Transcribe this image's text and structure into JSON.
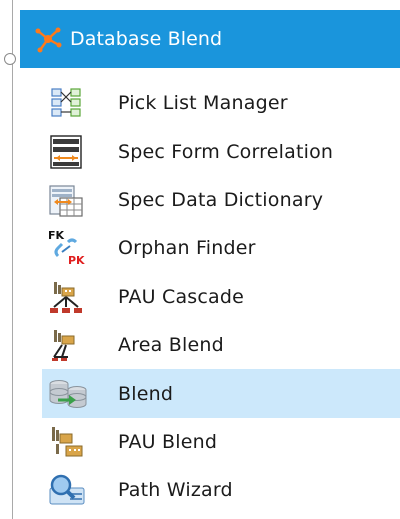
{
  "tree": {
    "group": {
      "label": "Database Blend",
      "icon": "database-blend-icon",
      "color": "#1a95dc"
    },
    "items": [
      {
        "label": "Pick List Manager",
        "icon": "pick-list-manager-icon"
      },
      {
        "label": "Spec Form Correlation",
        "icon": "spec-form-correlation-icon"
      },
      {
        "label": "Spec Data Dictionary",
        "icon": "spec-data-dictionary-icon"
      },
      {
        "label": "Orphan Finder",
        "icon": "orphan-finder-icon",
        "icon_text": {
          "fk": "FK",
          "pk": "PK"
        }
      },
      {
        "label": "PAU Cascade",
        "icon": "pau-cascade-icon"
      },
      {
        "label": "Area Blend",
        "icon": "area-blend-icon"
      },
      {
        "label": "Blend",
        "icon": "blend-icon",
        "selected": true
      },
      {
        "label": "PAU Blend",
        "icon": "pau-blend-icon"
      },
      {
        "label": "Path Wizard",
        "icon": "path-wizard-icon"
      }
    ],
    "selected_color": "#cce8fb"
  }
}
